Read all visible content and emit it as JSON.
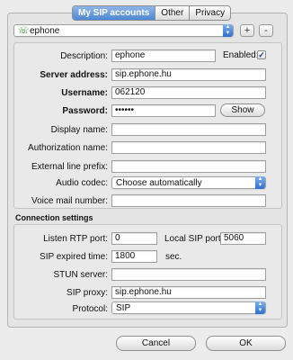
{
  "tabs": [
    {
      "label": "My SIP accounts",
      "active": true
    },
    {
      "label": "Other",
      "active": false
    },
    {
      "label": "Privacy",
      "active": false
    }
  ],
  "account_selector": {
    "value": "ephone"
  },
  "toolbar": {
    "add_label": "+",
    "remove_label": "-"
  },
  "account": {
    "description_label": "Description:",
    "description_value": "ephone",
    "enabled_label": "Enabled:",
    "enabled_checked": true,
    "enabled_mark": "✓",
    "server_address_label": "Server address:",
    "server_address_value": "sip.ephone.hu",
    "username_label": "Username:",
    "username_value": "062120",
    "password_label": "Password:",
    "password_value": "••••••",
    "show_label": "Show",
    "display_name_label": "Display name:",
    "auth_name_label": "Authorization name:",
    "ext_prefix_label": "External line prefix:",
    "audio_codec_label": "Audio codec:",
    "audio_codec_value": "Choose automatically",
    "voicemail_label": "Voice mail number:"
  },
  "connection": {
    "title": "Connection settings",
    "listen_rtp_label": "Listen RTP port:",
    "listen_rtp_value": "0",
    "local_sip_label": "Local SIP port:",
    "local_sip_value": "5060",
    "sip_expired_label": "SIP expired time:",
    "sip_expired_value": "1800",
    "sec_label": "sec.",
    "stun_label": "STUN server:",
    "sip_proxy_label": "SIP proxy:",
    "sip_proxy_value": "sip.ephone.hu",
    "protocol_label": "Protocol:",
    "protocol_value": "SIP"
  },
  "buttons": {
    "cancel_label": "Cancel",
    "ok_label": "OK"
  }
}
